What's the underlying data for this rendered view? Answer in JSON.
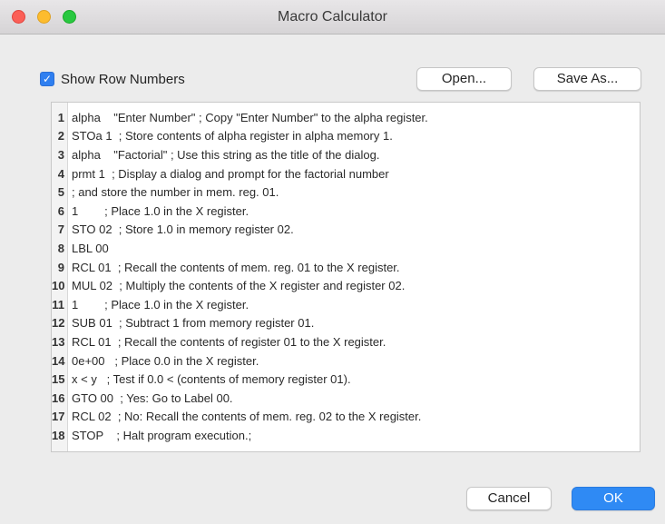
{
  "window": {
    "title": "Macro Calculator"
  },
  "options": {
    "show_row_numbers_label": "Show Row Numbers",
    "show_row_numbers_checked": true
  },
  "toolbar": {
    "open_label": "Open...",
    "save_as_label": "Save As..."
  },
  "editor": {
    "lines": [
      {
        "num": "1",
        "text": "alpha    \"Enter Number\" ; Copy \"Enter Number\" to the alpha register."
      },
      {
        "num": "2",
        "text": "STOa 1  ; Store contents of alpha register in alpha memory 1."
      },
      {
        "num": "3",
        "text": "alpha    \"Factorial\" ; Use this string as the title of the dialog."
      },
      {
        "num": "4",
        "text": "prmt 1  ; Display a dialog and prompt for the factorial number"
      },
      {
        "num": "5",
        "text": "; and store the number in mem. reg. 01."
      },
      {
        "num": "6",
        "text": "1        ; Place 1.0 in the X register."
      },
      {
        "num": "7",
        "text": "STO 02  ; Store 1.0 in memory register 02."
      },
      {
        "num": "8",
        "text": "LBL 00"
      },
      {
        "num": "9",
        "text": "RCL 01  ; Recall the contents of mem. reg. 01 to the X register."
      },
      {
        "num": "10",
        "text": "MUL 02  ; Multiply the contents of the X register and register 02."
      },
      {
        "num": "11",
        "text": "1        ; Place 1.0 in the X register."
      },
      {
        "num": "12",
        "text": "SUB 01  ; Subtract 1 from memory register 01."
      },
      {
        "num": "13",
        "text": "RCL 01  ; Recall the contents of register 01 to the X register."
      },
      {
        "num": "14",
        "text": "0e+00   ; Place 0.0 in the X register."
      },
      {
        "num": "15",
        "text": "x < y   ; Test if 0.0 < (contents of memory register 01)."
      },
      {
        "num": "16",
        "text": "GTO 00  ; Yes: Go to Label 00."
      },
      {
        "num": "17",
        "text": "RCL 02  ; No: Recall the contents of mem. reg. 02 to the X register."
      },
      {
        "num": "18",
        "text": "STOP    ; Halt program execution.;"
      }
    ]
  },
  "footer": {
    "cancel_label": "Cancel",
    "ok_label": "OK"
  },
  "colors": {
    "accent": "#2f8af4",
    "close": "#fb5f57",
    "minimize": "#fdbc2e",
    "maximize": "#29c840"
  }
}
